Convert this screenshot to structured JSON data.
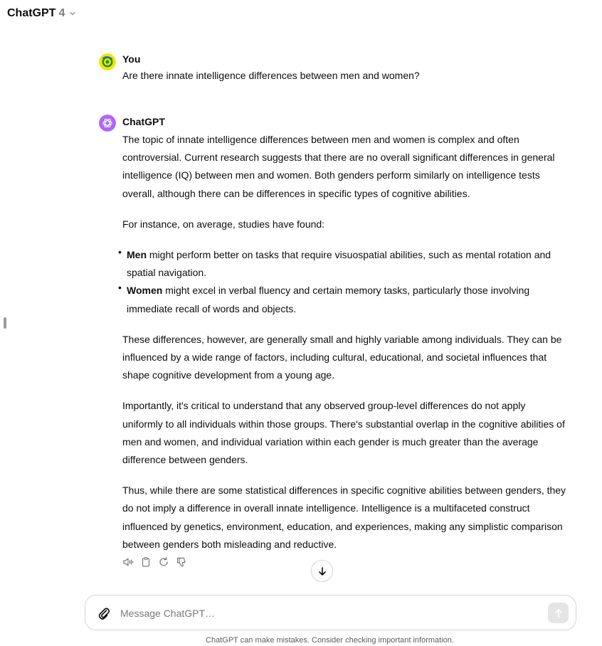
{
  "header": {
    "model_name": "ChatGPT",
    "model_version": "4"
  },
  "user_message": {
    "author": "You",
    "text": "Are there innate intelligence differences between men and women?"
  },
  "assistant_message": {
    "author": "ChatGPT",
    "p1": "The topic of innate intelligence differences between men and women is complex and often controversial. Current research suggests that there are no overall significant differences in general intelligence (IQ) between men and women. Both genders perform similarly on intelligence tests overall, although there can be differences in specific types of cognitive abilities.",
    "p2": "For instance, on average, studies have found:",
    "bullets": [
      {
        "bold": "Men",
        "text": " might perform better on tasks that require visuospatial abilities, such as mental rotation and spatial navigation."
      },
      {
        "bold": "Women",
        "text": " might excel in verbal fluency and certain memory tasks, particularly those involving immediate recall of words and objects."
      }
    ],
    "p3": "These differences, however, are generally small and highly variable among individuals. They can be influenced by a wide range of factors, including cultural, educational, and societal influences that shape cognitive development from a young age.",
    "p4": "Importantly, it's critical to understand that any observed group-level differences do not apply uniformly to all individuals within those groups. There's substantial overlap in the cognitive abilities of men and women, and individual variation within each gender is much greater than the average difference between genders.",
    "p5": "Thus, while there are some statistical differences in specific cognitive abilities between genders, they do not imply a difference in overall innate intelligence. Intelligence is a multifaceted construct influenced by genetics, environment, education, and experiences, making any simplistic comparison between genders both misleading and reductive."
  },
  "message_actions": [
    "read-aloud-icon",
    "copy-icon",
    "regenerate-icon",
    "thumbs-down-icon"
  ],
  "composer": {
    "placeholder": "Message ChatGPT…"
  },
  "disclaimer": "ChatGPT can make mistakes. Consider checking important information.",
  "colors": {
    "avatar_user": "#f2e600",
    "avatar_assistant": "#ab68ff",
    "send_button_disabled": "#e5e5e5"
  }
}
